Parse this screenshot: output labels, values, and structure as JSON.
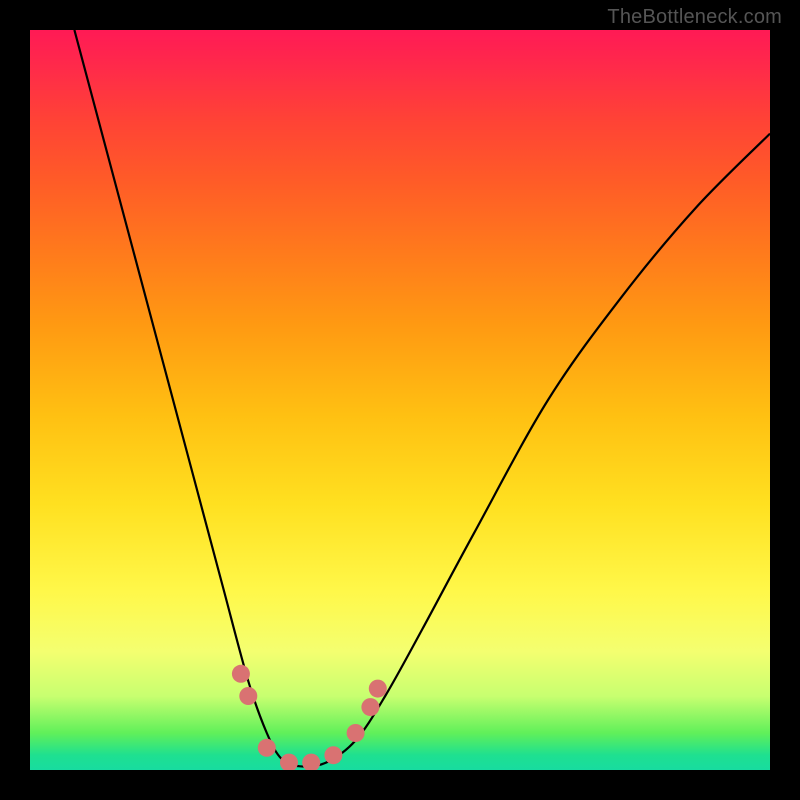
{
  "watermark": "TheBottleneck.com",
  "chart_data": {
    "type": "line",
    "title": "",
    "xlabel": "",
    "ylabel": "",
    "xlim": [
      0,
      1
    ],
    "ylim": [
      0,
      1
    ],
    "series": [
      {
        "name": "bottleneck-curve",
        "x": [
          0.06,
          0.1,
          0.14,
          0.18,
          0.22,
          0.26,
          0.295,
          0.32,
          0.34,
          0.365,
          0.4,
          0.44,
          0.48,
          0.53,
          0.6,
          0.7,
          0.8,
          0.9,
          1.0
        ],
        "values": [
          1.0,
          0.85,
          0.7,
          0.55,
          0.4,
          0.25,
          0.12,
          0.05,
          0.015,
          0.005,
          0.01,
          0.04,
          0.1,
          0.19,
          0.32,
          0.5,
          0.64,
          0.76,
          0.86
        ]
      }
    ],
    "markers": {
      "name": "highlight-points",
      "color": "#d97272",
      "x": [
        0.285,
        0.295,
        0.32,
        0.35,
        0.38,
        0.41,
        0.44,
        0.46,
        0.47
      ],
      "values": [
        0.13,
        0.1,
        0.03,
        0.01,
        0.01,
        0.02,
        0.05,
        0.085,
        0.11
      ]
    }
  }
}
